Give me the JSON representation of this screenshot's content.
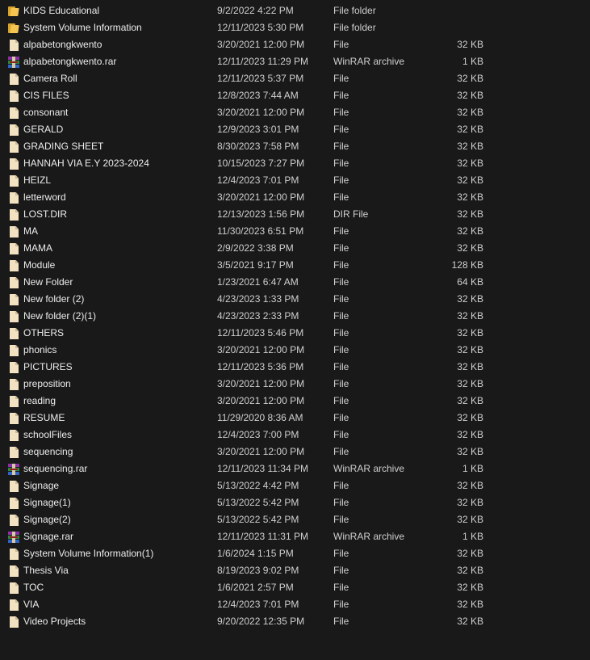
{
  "files": [
    {
      "name": "KIDS Educational",
      "date": "9/2/2022 4:22 PM",
      "type": "File folder",
      "size": "",
      "icon": "folder-icon"
    },
    {
      "name": "System Volume Information",
      "date": "12/11/2023 5:30 PM",
      "type": "File folder",
      "size": "",
      "icon": "folder-icon"
    },
    {
      "name": "alpabetongkwento",
      "date": "3/20/2021 12:00 PM",
      "type": "File",
      "size": "32 KB",
      "icon": "file-icon"
    },
    {
      "name": "alpabetongkwento.rar",
      "date": "12/11/2023 11:29 PM",
      "type": "WinRAR archive",
      "size": "1 KB",
      "icon": "winrar-archive-icon"
    },
    {
      "name": "Camera Roll",
      "date": "12/11/2023 5:37 PM",
      "type": "File",
      "size": "32 KB",
      "icon": "file-icon"
    },
    {
      "name": "CIS FILES",
      "date": "12/8/2023 7:44 AM",
      "type": "File",
      "size": "32 KB",
      "icon": "file-icon"
    },
    {
      "name": "consonant",
      "date": "3/20/2021 12:00 PM",
      "type": "File",
      "size": "32 KB",
      "icon": "file-icon"
    },
    {
      "name": "GERALD",
      "date": "12/9/2023 3:01 PM",
      "type": "File",
      "size": "32 KB",
      "icon": "file-icon"
    },
    {
      "name": "GRADING SHEET",
      "date": "8/30/2023 7:58 PM",
      "type": "File",
      "size": "32 KB",
      "icon": "file-icon"
    },
    {
      "name": "HANNAH VIA E.Y 2023-2024",
      "date": "10/15/2023 7:27 PM",
      "type": "File",
      "size": "32 KB",
      "icon": "file-icon"
    },
    {
      "name": "HEIZL",
      "date": "12/4/2023 7:01 PM",
      "type": "File",
      "size": "32 KB",
      "icon": "file-icon"
    },
    {
      "name": "letterword",
      "date": "3/20/2021 12:00 PM",
      "type": "File",
      "size": "32 KB",
      "icon": "file-icon"
    },
    {
      "name": "LOST.DIR",
      "date": "12/13/2023 1:56 PM",
      "type": "DIR File",
      "size": "32 KB",
      "icon": "file-icon"
    },
    {
      "name": "MA",
      "date": "11/30/2023 6:51 PM",
      "type": "File",
      "size": "32 KB",
      "icon": "file-icon"
    },
    {
      "name": "MAMA",
      "date": "2/9/2022 3:38 PM",
      "type": "File",
      "size": "32 KB",
      "icon": "file-icon"
    },
    {
      "name": "Module",
      "date": "3/5/2021 9:17 PM",
      "type": "File",
      "size": "128 KB",
      "icon": "file-icon"
    },
    {
      "name": "New Folder",
      "date": "1/23/2021 6:47 AM",
      "type": "File",
      "size": "64 KB",
      "icon": "file-icon"
    },
    {
      "name": "New folder (2)",
      "date": "4/23/2023 1:33 PM",
      "type": "File",
      "size": "32 KB",
      "icon": "file-icon"
    },
    {
      "name": "New folder (2)(1)",
      "date": "4/23/2023 2:33 PM",
      "type": "File",
      "size": "32 KB",
      "icon": "file-icon"
    },
    {
      "name": "OTHERS",
      "date": "12/11/2023 5:46 PM",
      "type": "File",
      "size": "32 KB",
      "icon": "file-icon"
    },
    {
      "name": "phonics",
      "date": "3/20/2021 12:00 PM",
      "type": "File",
      "size": "32 KB",
      "icon": "file-icon"
    },
    {
      "name": "PICTURES",
      "date": "12/11/2023 5:36 PM",
      "type": "File",
      "size": "32 KB",
      "icon": "file-icon"
    },
    {
      "name": "preposition",
      "date": "3/20/2021 12:00 PM",
      "type": "File",
      "size": "32 KB",
      "icon": "file-icon"
    },
    {
      "name": "reading",
      "date": "3/20/2021 12:00 PM",
      "type": "File",
      "size": "32 KB",
      "icon": "file-icon"
    },
    {
      "name": "RESUME",
      "date": "11/29/2020 8:36 AM",
      "type": "File",
      "size": "32 KB",
      "icon": "file-icon"
    },
    {
      "name": "schoolFiles",
      "date": "12/4/2023 7:00 PM",
      "type": "File",
      "size": "32 KB",
      "icon": "file-icon"
    },
    {
      "name": "sequencing",
      "date": "3/20/2021 12:00 PM",
      "type": "File",
      "size": "32 KB",
      "icon": "file-icon"
    },
    {
      "name": "sequencing.rar",
      "date": "12/11/2023 11:34 PM",
      "type": "WinRAR archive",
      "size": "1 KB",
      "icon": "winrar-archive-icon"
    },
    {
      "name": "Signage",
      "date": "5/13/2022 4:42 PM",
      "type": "File",
      "size": "32 KB",
      "icon": "file-icon"
    },
    {
      "name": "Signage(1)",
      "date": "5/13/2022 5:42 PM",
      "type": "File",
      "size": "32 KB",
      "icon": "file-icon"
    },
    {
      "name": "Signage(2)",
      "date": "5/13/2022 5:42 PM",
      "type": "File",
      "size": "32 KB",
      "icon": "file-icon"
    },
    {
      "name": "Signage.rar",
      "date": "12/11/2023 11:31 PM",
      "type": "WinRAR archive",
      "size": "1 KB",
      "icon": "winrar-archive-icon"
    },
    {
      "name": "System Volume Information(1)",
      "date": "1/6/2024 1:15 PM",
      "type": "File",
      "size": "32 KB",
      "icon": "file-icon"
    },
    {
      "name": "Thesis Via",
      "date": "8/19/2023 9:02 PM",
      "type": "File",
      "size": "32 KB",
      "icon": "file-icon"
    },
    {
      "name": "TOC",
      "date": "1/6/2021 2:57 PM",
      "type": "File",
      "size": "32 KB",
      "icon": "file-icon"
    },
    {
      "name": "VIA",
      "date": "12/4/2023 7:01 PM",
      "type": "File",
      "size": "32 KB",
      "icon": "file-icon"
    },
    {
      "name": "Video Projects",
      "date": "9/20/2022 12:35 PM",
      "type": "File",
      "size": "32 KB",
      "icon": "file-icon"
    }
  ]
}
